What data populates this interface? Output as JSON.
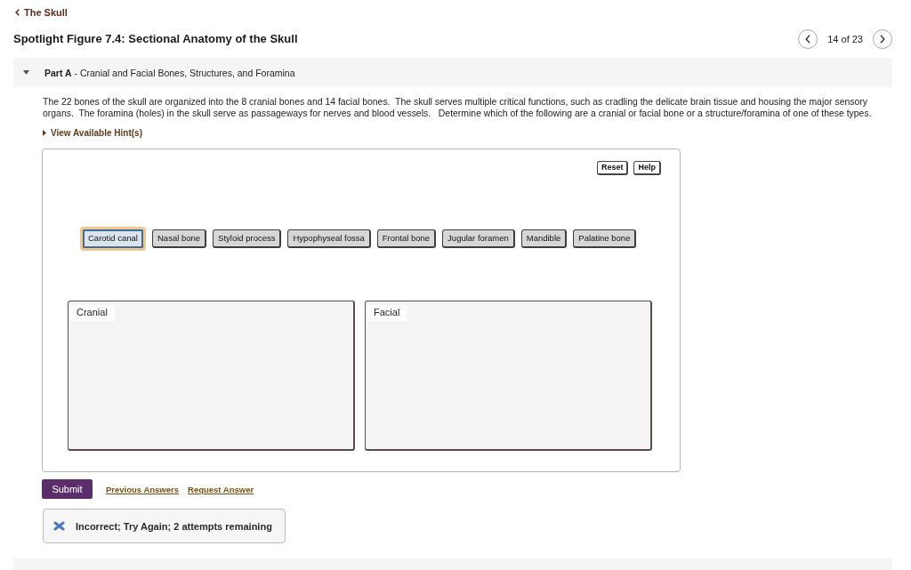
{
  "breadcrumb": {
    "label": "The Skull"
  },
  "title": "Spotlight Figure 7.4: Sectional Anatomy of the Skull",
  "pager": {
    "position": "14 of 23"
  },
  "part": {
    "title": "**Part A** - Cranial and Facial Bones, Structures, and Foramina",
    "expanded": true
  },
  "instructions": "The 22 bones of the skull are organized into the 8 cranial bones and 14 facial bones.  The skull serves multiple critical functions, such as cradling the delicate brain tissue and housing the major sensory organs.  The foramina (holes) in the skull serve as passageways for nerves and blood vessels.   Determine which of the following are a cranial or facial bone or a structure/foramina of one of these types.",
  "hints": {
    "label": "View Available Hint(s)",
    "expanded": false
  },
  "tool_buttons": [
    "Reset",
    "Help"
  ],
  "items": [
    {
      "label": "Carotid canal",
      "selected": true
    },
    {
      "label": "Nasal bone",
      "selected": false
    },
    {
      "label": "Styloid process",
      "selected": false
    },
    {
      "label": "Hypophyseal fossa",
      "selected": false
    },
    {
      "label": "Frontal bone",
      "selected": false
    },
    {
      "label": "Jugular foramen",
      "selected": false
    },
    {
      "label": "Mandible",
      "selected": false
    },
    {
      "label": "Palatine bone",
      "selected": false
    }
  ],
  "bins": [
    {
      "label": "Cranial"
    },
    {
      "label": "Facial"
    }
  ],
  "submit": {
    "label": "Submit"
  },
  "links": [
    "Previous Answers",
    "Request Answer"
  ],
  "feedback": {
    "kind": "incorrect",
    "message": "Incorrect; Try Again; 2 attempts remaining"
  }
}
